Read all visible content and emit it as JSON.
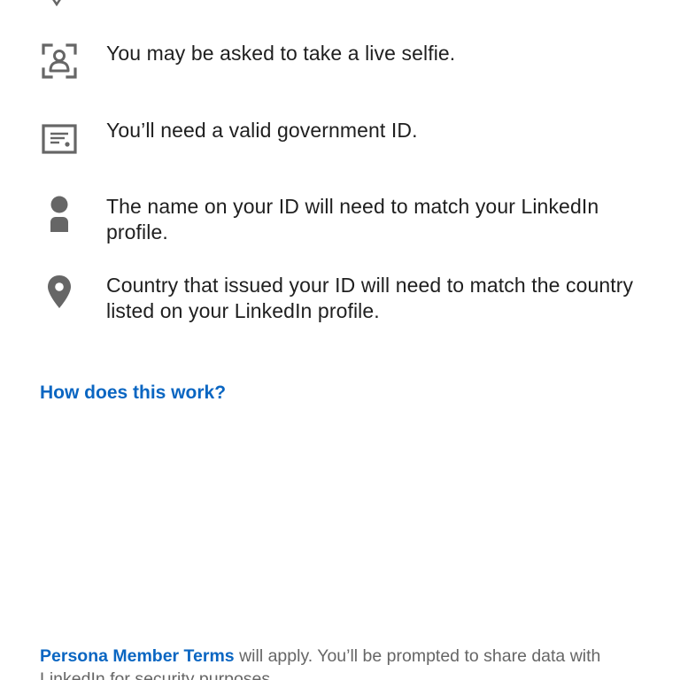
{
  "requirements": [
    {
      "icon": "selfie-camera-icon",
      "text": "You may be asked to take a live selfie."
    },
    {
      "icon": "id-card-icon",
      "text": "You’ll need a valid government ID."
    },
    {
      "icon": "person-icon",
      "text": "The name on your ID will need to match your LinkedIn profile."
    },
    {
      "icon": "location-pin-icon",
      "text": "Country that issued your ID will need to match the country listed on your LinkedIn profile."
    }
  ],
  "how_link": "How does this work?",
  "footer": {
    "terms_link": "Persona Member Terms",
    "text": " will apply. You’ll be prompted to share data with LinkedIn for security purposes."
  },
  "colors": {
    "text": "#1f1f1f",
    "icon": "#666666",
    "link": "#0a66c2",
    "muted": "#666666",
    "background": "#ffffff"
  }
}
